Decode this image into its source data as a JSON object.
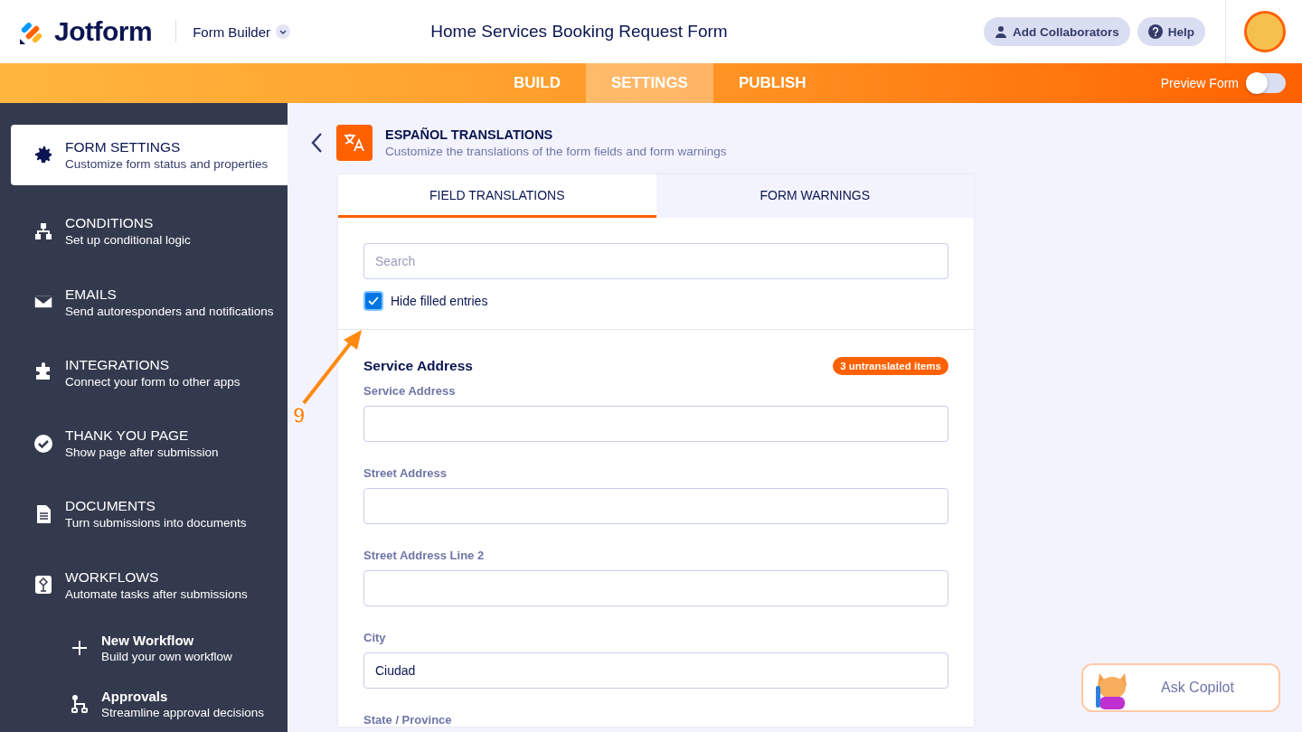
{
  "header": {
    "logo": "Jotform",
    "builder_menu": "Form Builder",
    "form_title": "Home Services Booking Request Form",
    "buttons": [
      {
        "kind": "collaborators",
        "label": "Add Collaborators"
      },
      {
        "kind": "help",
        "label": "Help"
      }
    ]
  },
  "nav": {
    "tabs": [
      {
        "label": "BUILD",
        "selected": false
      },
      {
        "label": "SETTINGS",
        "selected": true
      },
      {
        "label": "PUBLISH",
        "selected": false
      }
    ],
    "preview": {
      "label": "Preview Form",
      "on": false
    }
  },
  "sidebar": {
    "items": [
      {
        "kind": "section",
        "title": "FORM SETTINGS",
        "subtitle": "Customize form status and properties",
        "selected": true
      },
      {
        "kind": "section",
        "title": "CONDITIONS",
        "subtitle": "Set up conditional logic",
        "selected": false
      },
      {
        "kind": "section",
        "title": "EMAILS",
        "subtitle": "Send autoresponders and notifications",
        "selected": false
      },
      {
        "kind": "section",
        "title": "INTEGRATIONS",
        "subtitle": "Connect your form to other apps",
        "selected": false
      },
      {
        "kind": "section",
        "title": "THANK YOU PAGE",
        "subtitle": "Show page after submission",
        "selected": false
      },
      {
        "kind": "section",
        "title": "DOCUMENTS",
        "subtitle": "Turn submissions into documents",
        "selected": false
      },
      {
        "kind": "section",
        "title": "WORKFLOWS",
        "subtitle": "Automate tasks after submissions",
        "selected": false
      },
      {
        "kind": "sub",
        "title": "New Workflow",
        "subtitle": "Build your own workflow",
        "selected": false
      },
      {
        "kind": "sub",
        "title": "Approvals",
        "subtitle": "Streamline approval decisions",
        "selected": false
      }
    ]
  },
  "panel": {
    "title": "ESPAÑOL TRANSLATIONS",
    "subtitle": "Customize the translations of the form fields and form warnings",
    "tabs": [
      {
        "label": "FIELD TRANSLATIONS",
        "selected": true
      },
      {
        "label": "FORM WARNINGS",
        "selected": false
      }
    ],
    "search": {
      "placeholder": "Search"
    },
    "hide_filled": {
      "label": "Hide filled entries",
      "checked": true
    },
    "section": {
      "title": "Service Address",
      "badge": "3 untranslated items"
    },
    "fields": [
      {
        "label": "Service Address"
      },
      {
        "label": "Street Address"
      },
      {
        "label": "Street Address Line 2"
      },
      {
        "label": "City",
        "value": "Ciudad"
      },
      {
        "label": "State / Province"
      }
    ]
  },
  "annotation": {
    "step": "9"
  },
  "copilot": {
    "label": "Ask Copilot"
  }
}
